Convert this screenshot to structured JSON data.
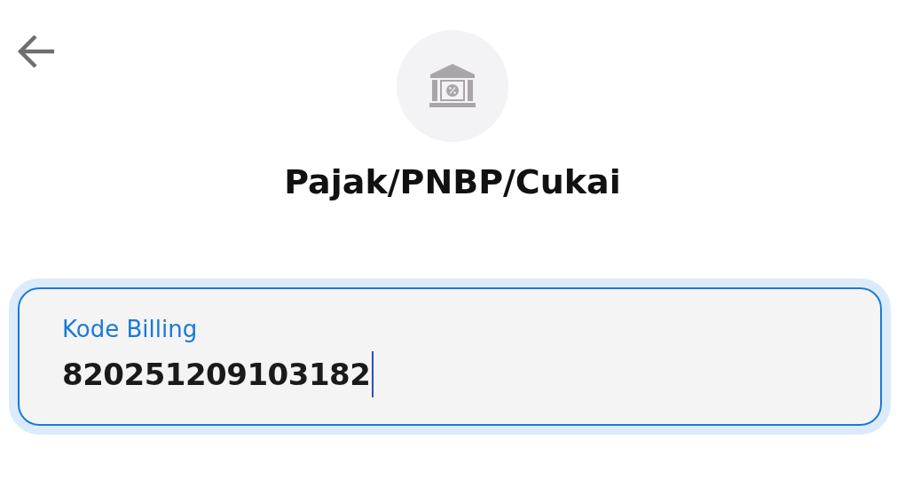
{
  "title": "Pajak/PNBP/Cukai",
  "field": {
    "label": "Kode Billing",
    "value": "820251209103182",
    "focused": true
  }
}
